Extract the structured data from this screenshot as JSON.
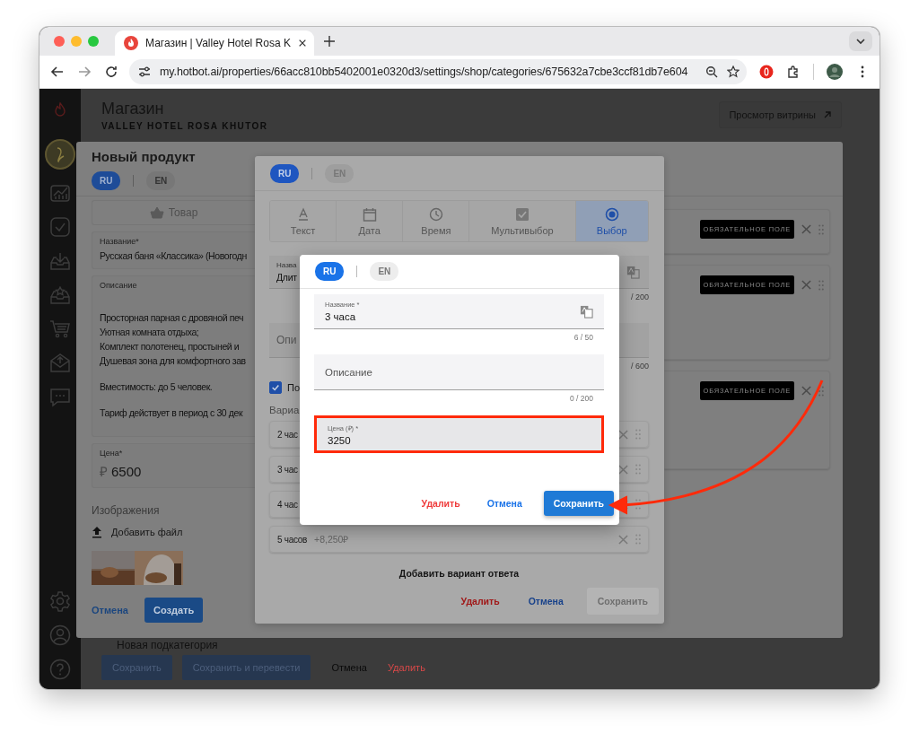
{
  "browser": {
    "tab_title": "Магазин | Valley Hotel Rosa K",
    "url": "my.hotbot.ai/properties/66acc810bb5402001e0320d3/settings/shop/categories/675632a7cbe3ccf81db7e604"
  },
  "page": {
    "title": "Магазин",
    "subtitle": "VALLEY HOTEL ROSA KHUTOR",
    "storefront_button": "Просмотр витрины",
    "new_subcategory": "Новая подкатегория",
    "buttons": [
      {
        "label": "Сохранить",
        "kind": "primary"
      },
      {
        "label": "Сохранить и перевести",
        "kind": "primary"
      },
      {
        "label": "Отмена",
        "kind": "link"
      },
      {
        "label": "Удалить",
        "kind": "danger"
      }
    ]
  },
  "product_dialog": {
    "title": "Новый продукт",
    "languages": [
      {
        "label": "RU",
        "selected": true
      },
      {
        "label": "EN",
        "selected": false
      }
    ],
    "type_tab": "Товар",
    "name": {
      "label": "Название*",
      "value": "Русская баня «Классика» (Новогодн"
    },
    "description": {
      "label": "Описание",
      "paragraphs": [
        [
          "Просторная парная с дровяной печ",
          "Уютная комната отдыха;",
          "Комплект полотенец, простыней и",
          "Душевая зона для комфортного зав"
        ],
        [
          "Вместимость: до 5 человек."
        ],
        [
          "Тариф действует в период с 30 дек"
        ]
      ]
    },
    "price": {
      "label": "Цена*",
      "currency": "₽",
      "value": "6500"
    },
    "images_label": "Изображения",
    "add_file": "Добавить файл",
    "field_cards": [
      {
        "badge": "ОБЯЗАТЕЛЬНОЕ ПОЛЕ"
      },
      {
        "badge": "ОБЯЗАТЕЛЬНОЕ ПОЛЕ"
      },
      {
        "badge": "ОБЯЗАТЕЛЬНОЕ ПОЛЕ"
      }
    ],
    "buttons": [
      {
        "label": "Отмена",
        "kind": "link"
      },
      {
        "label": "Создать",
        "kind": "primary"
      }
    ]
  },
  "field_dialog": {
    "languages": [
      {
        "label": "RU",
        "selected": true
      },
      {
        "label": "EN",
        "selected": false
      }
    ],
    "types": [
      {
        "label": "Текст",
        "selected": false
      },
      {
        "label": "Дата",
        "selected": false
      },
      {
        "label": "Время",
        "selected": false
      },
      {
        "label": "Мультивыбор",
        "selected": false
      },
      {
        "label": "Выбор",
        "selected": true
      }
    ],
    "name": {
      "label": "Назва",
      "value": "Длит",
      "counter": "/ 200"
    },
    "description": {
      "label": "Опи",
      "counter": "/ 600"
    },
    "checkbox": {
      "label": "По",
      "checked": true
    },
    "variants_label": "Вариа",
    "variants": [
      {
        "label": "2 час"
      },
      {
        "label": "3 час"
      },
      {
        "label": "4 час"
      },
      {
        "label": "5 часов",
        "price": "+8,250₽"
      }
    ],
    "add_variant": "Добавить вариант ответа",
    "buttons": [
      {
        "label": "Удалить",
        "kind": "danger",
        "disabled": false
      },
      {
        "label": "Отмена",
        "kind": "link",
        "disabled": false
      },
      {
        "label": "Сохранить",
        "kind": "primary",
        "disabled": true
      }
    ]
  },
  "variant_dialog": {
    "languages": [
      {
        "label": "RU",
        "selected": true
      },
      {
        "label": "EN",
        "selected": false
      }
    ],
    "name": {
      "label": "Название *",
      "value": "3 часа",
      "counter": "6 / 50"
    },
    "description": {
      "placeholder": "Описание",
      "counter": "0 / 200"
    },
    "price": {
      "label": "Цена (₽) *",
      "value": "3250",
      "highlighted": true
    },
    "buttons": [
      {
        "label": "Удалить",
        "kind": "danger"
      },
      {
        "label": "Отмена",
        "kind": "link"
      },
      {
        "label": "Сохранить",
        "kind": "primary"
      }
    ]
  }
}
